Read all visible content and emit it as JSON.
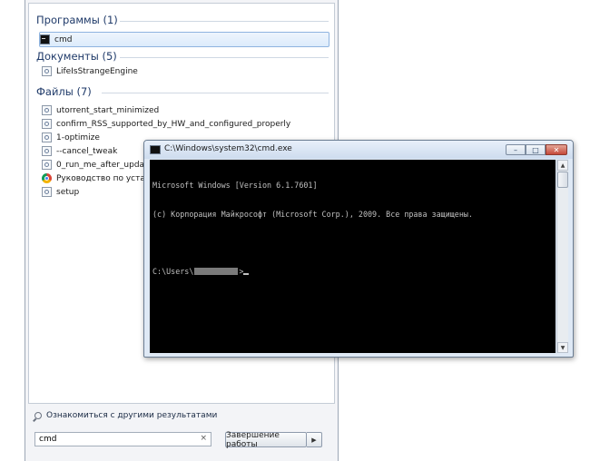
{
  "start_menu": {
    "groups": [
      {
        "header": "Программы (1)",
        "items": [
          {
            "label": "cmd",
            "icon": "cmd-icon",
            "selected": true
          }
        ]
      },
      {
        "header": "Документы (5)",
        "items": [
          {
            "label": "LifeIsStrangeEngine",
            "icon": "file-icon"
          }
        ]
      },
      {
        "header": "Файлы (7)",
        "items": [
          {
            "label": "utorrent_start_minimized",
            "icon": "file-icon"
          },
          {
            "label": "confirm_RSS_supported_by_HW_and_configured_properly",
            "icon": "file-icon"
          },
          {
            "label": "1-optimize",
            "icon": "file-icon"
          },
          {
            "label": "--cancel_tweak",
            "icon": "file-icon"
          },
          {
            "label": "0_run_me_after_update",
            "icon": "file-icon"
          },
          {
            "label": "Руководство по установк",
            "icon": "chrome-icon"
          },
          {
            "label": "setup",
            "icon": "file-icon"
          }
        ]
      }
    ],
    "more_results_label": "Ознакомиться с другими результатами",
    "search": {
      "value": "cmd",
      "clear_glyph": "×"
    },
    "shutdown_label": "Завершение работы",
    "shutdown_arrow": "▶"
  },
  "cmd_window": {
    "title": "C:\\Windows\\system32\\cmd.exe",
    "buttons": {
      "minimize": "–",
      "maximize": "□",
      "close": "✕"
    },
    "console": {
      "line1": "Microsoft Windows [Version 6.1.7601]",
      "line2": "(c) Корпорация Майкрософт (Microsoft Corp.), 2009. Все права защищены.",
      "prompt_prefix": "C:\\Users\\",
      "prompt_suffix": ">"
    },
    "scroll": {
      "up": "▲",
      "down": "▼"
    }
  }
}
